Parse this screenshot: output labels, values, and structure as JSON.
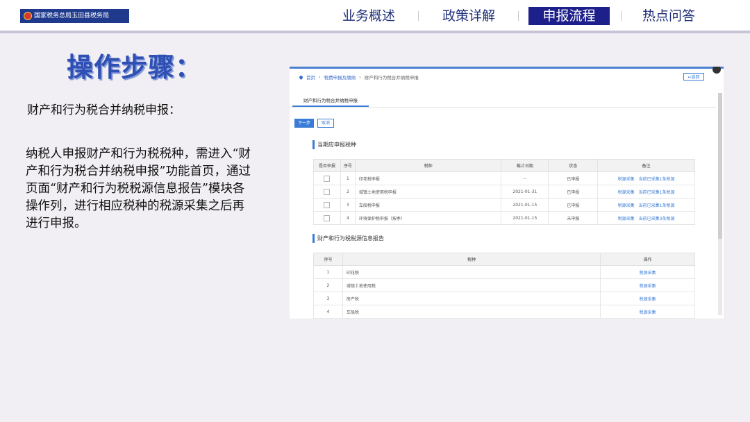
{
  "header": {
    "logo_text": "国家税务总局玉田县税务局",
    "nav": [
      {
        "label": "业务概述",
        "active": false
      },
      {
        "label": "政策详解",
        "active": false
      },
      {
        "label": "申报流程",
        "active": true
      },
      {
        "label": "热点问答",
        "active": false
      }
    ]
  },
  "content": {
    "title": "操作步骤：",
    "subtitle": "财产和行为税合并纳税申报：",
    "paragraph": "纳税人申报财产和行为税税种，需进入“财产和行为税合并纳税申报”功能首页，通过页面“财产和行为税税源信息报告”模块各操作列，进行相应税种的税源采集之后再进行申报。"
  },
  "screenshot": {
    "breadcrumb": [
      "首页",
      "税费申报及缴纳",
      "财产和行为税合并纳税申报"
    ],
    "back_button": "返回",
    "tab": "财产和行为税合并纳税申报",
    "next_button": "下一步",
    "cancel_button": "取消",
    "section1": {
      "title": "当期应申报税种",
      "headers": [
        "是否申报",
        "序号",
        "税种",
        "截止日期",
        "状态",
        "备注"
      ],
      "rows": [
        {
          "no": "1",
          "tax": "印花税申报",
          "deadline": "--",
          "status": "已申报",
          "action": "税源采集",
          "note": "当前已采集1条税源"
        },
        {
          "no": "2",
          "tax": "城镇土地使用税申报",
          "deadline": "2021-01-31",
          "status": "已申报",
          "action": "税源采集",
          "note": "当前已采集1条税源"
        },
        {
          "no": "3",
          "tax": "车船税申报",
          "deadline": "2021-01-15",
          "status": "已申报",
          "action": "税源采集",
          "note": "当前已采集1条税源"
        },
        {
          "no": "4",
          "tax": "环境保护税申报（按季）",
          "deadline": "2021-01-15",
          "status": "未申报",
          "action": "税源采集",
          "note": "当前已采集3条税源"
        }
      ]
    },
    "section2": {
      "title": "财产和行为税税源信息报告",
      "headers": [
        "序号",
        "税种",
        "操作"
      ],
      "rows": [
        {
          "no": "1",
          "tax": "印花税",
          "action": "税源采集"
        },
        {
          "no": "2",
          "tax": "城镇土地使用税",
          "action": "税源采集"
        },
        {
          "no": "3",
          "tax": "房产税",
          "action": "税源采集"
        },
        {
          "no": "4",
          "tax": "车船税",
          "action": "税源采集"
        }
      ]
    }
  },
  "colors": {
    "nav_active_bg": "#1d1f8a",
    "nav_text": "#1f2f7a",
    "title": "#2e4fb3",
    "link": "#3a7cd6"
  }
}
